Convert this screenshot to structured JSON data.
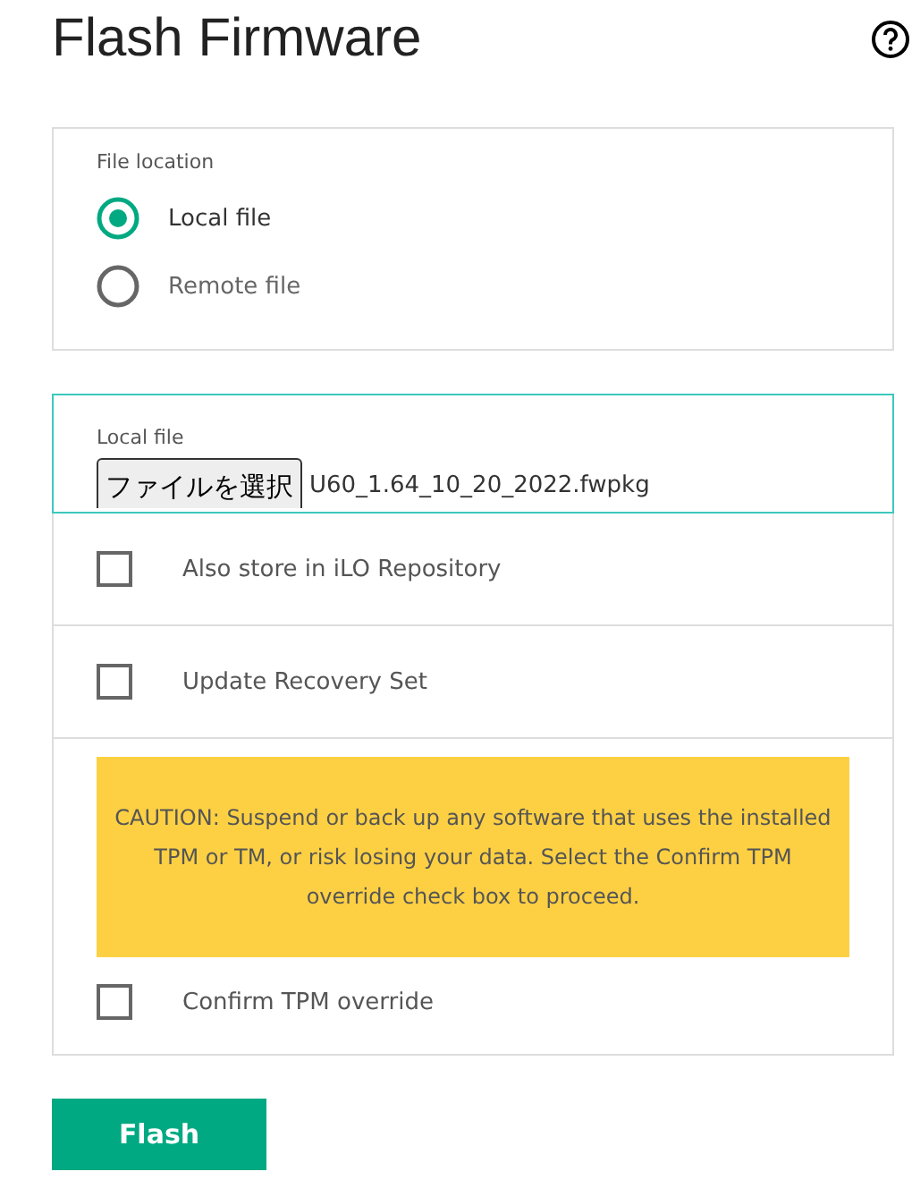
{
  "title": "Flash Firmware",
  "file_location": {
    "label": "File location",
    "options": [
      {
        "label": "Local file",
        "selected": true
      },
      {
        "label": "Remote file",
        "selected": false
      }
    ]
  },
  "local_file": {
    "label": "Local file",
    "button": "ファイルを選択",
    "filename": "U60_1.64_10_20_2022.fwpkg"
  },
  "options": [
    {
      "label": "Also store in iLO Repository",
      "checked": false
    },
    {
      "label": "Update Recovery Set",
      "checked": false
    }
  ],
  "caution": {
    "text": "CAUTION: Suspend or back up any software that uses the installed TPM or TM, or risk losing your data. Select the Confirm TPM override check box to proceed.",
    "checkbox": {
      "label": "Confirm TPM override",
      "checked": false
    }
  },
  "submit": "Flash"
}
